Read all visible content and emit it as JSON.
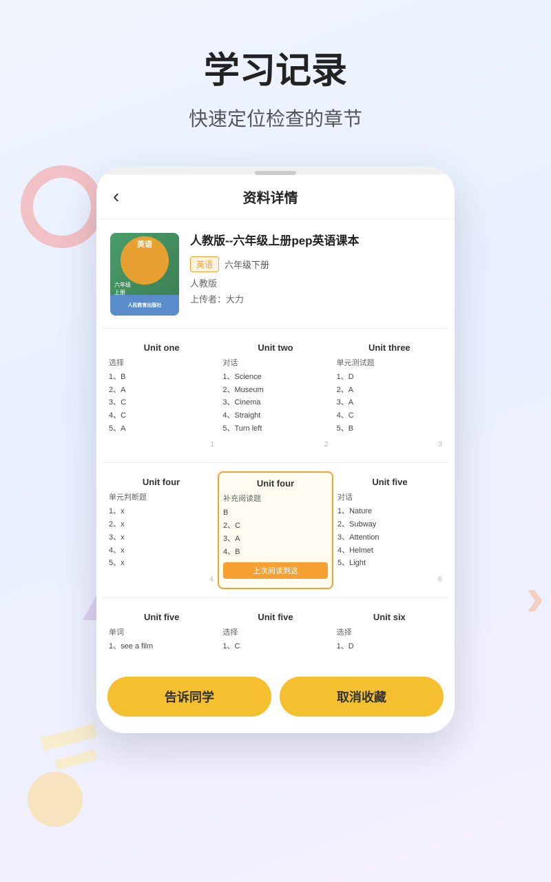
{
  "page": {
    "title": "学习记录",
    "subtitle": "快速定位检查的章节"
  },
  "nav": {
    "back_label": "‹",
    "title": "资料详情"
  },
  "book": {
    "title": "人教版--六年级上册pep英语课本",
    "tag_subject": "英语",
    "tag_grade": "六年级下册",
    "publisher": "人教版",
    "uploader": "上传者：大力",
    "cover_text": "英语",
    "cover_grade": "六年级\n上册"
  },
  "units": [
    {
      "id": 1,
      "header": "Unit one",
      "category": "选择",
      "items": [
        "1、B",
        "2、A",
        "3、C",
        "4、C",
        "5、A"
      ],
      "number": "1",
      "highlighted": false
    },
    {
      "id": 2,
      "header": "Unit two",
      "category": "对话",
      "items": [
        "1、Science",
        "2、Museum",
        "3、Cinema",
        "4、Straight",
        "5、Turn left"
      ],
      "number": "2",
      "highlighted": false
    },
    {
      "id": 3,
      "header": "Unit three",
      "category": "单元测试题",
      "items": [
        "1、D",
        "2、A",
        "3、A",
        "4、C",
        "5、B"
      ],
      "number": "3",
      "highlighted": false
    },
    {
      "id": 4,
      "header": "Unit four",
      "category": "单元判断题",
      "items": [
        "1、x",
        "2、x",
        "3、x",
        "4、x",
        "5、x"
      ],
      "number": "4",
      "highlighted": false
    },
    {
      "id": 5,
      "header": "Unit four",
      "category": "补充阅读题",
      "items": [
        "B",
        "2、C",
        "3、A",
        "4、B"
      ],
      "number": "",
      "highlighted": true,
      "last_read_badge": "上次阅读到这"
    },
    {
      "id": 6,
      "header": "Unit five",
      "category": "对话",
      "items": [
        "1、Nature",
        "2、Subway",
        "3、Attention",
        "4、Helmet",
        "5、Light"
      ],
      "number": "6",
      "highlighted": false
    },
    {
      "id": 7,
      "header": "Unit five",
      "category": "单词",
      "items": [
        "1、see a film"
      ],
      "number": "",
      "highlighted": false
    },
    {
      "id": 8,
      "header": "Unit five",
      "category": "选择",
      "items": [
        "1、C"
      ],
      "number": "",
      "highlighted": false
    },
    {
      "id": 9,
      "header": "Unit six",
      "category": "选择",
      "items": [
        "1、D"
      ],
      "number": "",
      "highlighted": false
    }
  ],
  "buttons": {
    "tell": "告诉同学",
    "uncollect": "取消收藏"
  }
}
